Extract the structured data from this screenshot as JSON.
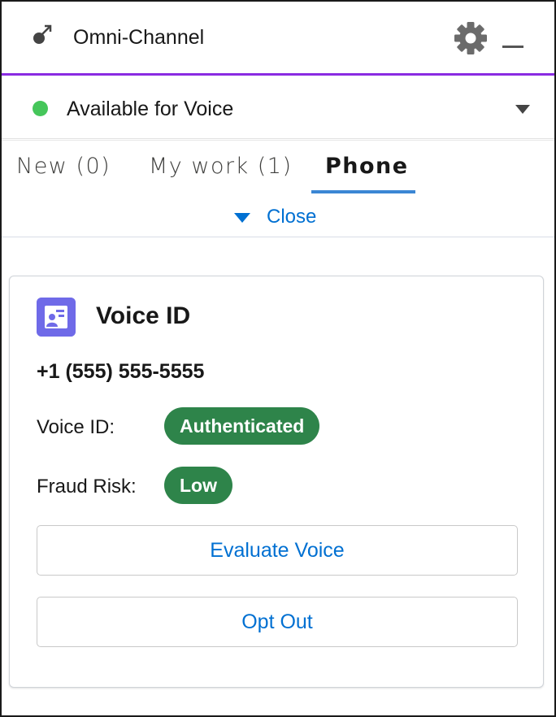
{
  "header": {
    "title": "Omni-Channel",
    "settings_icon": "gear-icon",
    "minimize_icon": "minimize-icon",
    "logo_icon": "omni-channel-logo-icon",
    "accent_color": "#8a2be2"
  },
  "status": {
    "label": "Available for Voice",
    "dot_color": "#45c65a"
  },
  "tabs": [
    {
      "label": "New (0)",
      "active": false
    },
    {
      "label": "My work (1)",
      "active": false
    },
    {
      "label": "Phone",
      "active": true
    }
  ],
  "close_label": "Close",
  "card": {
    "title": "Voice ID",
    "phone_number": "+1 (555) 555-5555",
    "voice_id_label": "Voice ID:",
    "voice_id_status": "Authenticated",
    "fraud_risk_label": "Fraud Risk:",
    "fraud_risk_value": "Low",
    "badge_color": "#2e844a",
    "evaluate_button": "Evaluate Voice",
    "opt_out_button": "Opt Out"
  }
}
